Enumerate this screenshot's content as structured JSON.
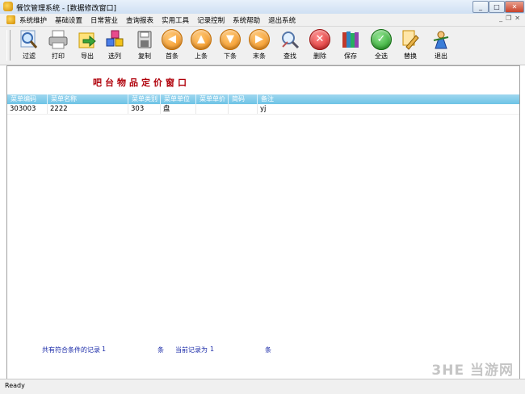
{
  "window": {
    "title": "餐饮管理系统 - [数据修改窗口]"
  },
  "menu": [
    "系统维护",
    "基础设置",
    "日常营业",
    "查询报表",
    "实用工具",
    "记录控制",
    "系统帮助",
    "退出系统"
  ],
  "toolbar": [
    {
      "label": "过滤",
      "icon": "magnifier-icon"
    },
    {
      "label": "打印",
      "icon": "printer-icon"
    },
    {
      "label": "导出",
      "icon": "export-icon"
    },
    {
      "label": "选列",
      "icon": "cubes-icon"
    },
    {
      "label": "复制",
      "icon": "copy-disk-icon"
    },
    {
      "label": "首条",
      "icon": "arrow-left-icon"
    },
    {
      "label": "上条",
      "icon": "arrow-up-icon"
    },
    {
      "label": "下条",
      "icon": "arrow-down-icon"
    },
    {
      "label": "末条",
      "icon": "arrow-right-icon"
    },
    {
      "label": "查找",
      "icon": "find-icon"
    },
    {
      "label": "删除",
      "icon": "delete-icon"
    },
    {
      "label": "保存",
      "icon": "books-icon"
    },
    {
      "label": "全选",
      "icon": "check-icon"
    },
    {
      "label": "替换",
      "icon": "replace-icon"
    },
    {
      "label": "退出",
      "icon": "exit-icon"
    }
  ],
  "content": {
    "heading": "吧台物品定价窗口",
    "columns": [
      "菜单编码",
      "菜单名称",
      "菜单类别",
      "菜单单位",
      "菜单单价",
      "简码",
      "备注"
    ],
    "rows": [
      [
        "303003",
        "2222",
        "303",
        "盘",
        "",
        "",
        "yj"
      ]
    ]
  },
  "footer": {
    "match_label": "共有符合条件的记录",
    "match_count": "1",
    "unit1": "条",
    "current_label": "当前记录为",
    "current_value": "1",
    "unit2": "条"
  },
  "status": "Ready",
  "watermark": "3HE 当游网"
}
